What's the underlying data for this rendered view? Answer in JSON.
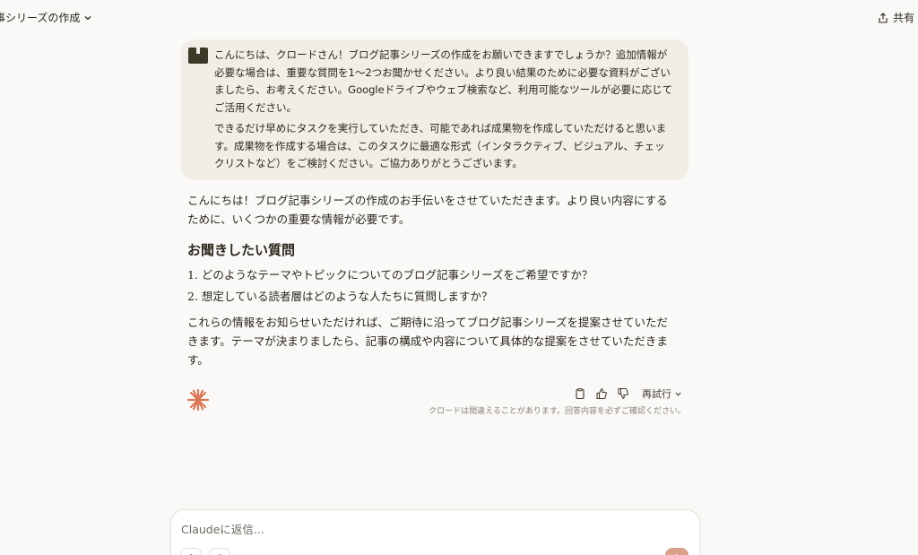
{
  "header": {
    "chat_title": "事シリーズの作成",
    "share_label": "共有"
  },
  "user_message": {
    "paragraph_1": "こんにちは、クロードさん！ブログ記事シリーズの作成をお願いできますでしょうか？追加情報が必要な場合は、重要な質問を1〜2つお聞かせください。より良い結果のために必要な資料がございましたら、お考えください。Googleドライブやウェブ検索など、利用可能なツールが必要に応じてご活用ください。",
    "paragraph_2": "できるだけ早めにタスクを実行していただき、可能であれば成果物を作成していただけると思います。成果物を作成する場合は、このタスクに最適な形式（インタラクティブ、ビジュアル、チェックリストなど）をご検討ください。ご協力ありがとうございます。"
  },
  "assistant_message": {
    "intro": "こんにちは！ブログ記事シリーズの作成のお手伝いをさせていただきます。より良い内容にするために、いくつかの重要な情報が必要です。",
    "heading": "お聞きしたい質問",
    "questions": [
      "1. どのようなテーマやトピックについてのブログ記事シリーズをご希望ですか？",
      "2. 想定している読者層はどのような人たちに質問しますか？"
    ],
    "closing": "これらの情報をお知らせいただければ、ご期待に沿ってブログ記事シリーズを提案させていただきます。テーマが決まりましたら、記事の構成や内容について具体的な提案をさせていただきます。"
  },
  "message_actions": {
    "retry_label": "再試行",
    "disclaimer": "クロードは間違えることがあります。回答内容を必ずご確認ください。"
  },
  "composer": {
    "placeholder": "Claudeに返信..."
  },
  "colors": {
    "background": "#faf9f7",
    "user_bubble": "#f0eee6",
    "accent": "#d97757",
    "send_button": "#d9a08a"
  },
  "icons": {
    "chevron": "chevron-down-icon",
    "share": "share-icon",
    "avatar": "user-avatar-icon",
    "logo": "claude-spark-icon",
    "copy": "copy-icon",
    "thumbs_up": "thumbs-up-icon",
    "thumbs_down": "thumbs-down-icon"
  }
}
